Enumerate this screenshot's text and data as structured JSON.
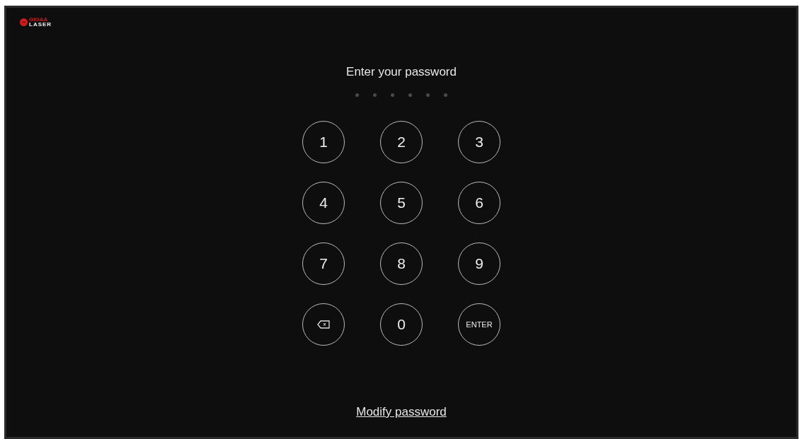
{
  "logo": {
    "line_1": "GIGAA",
    "line_2": "LASER"
  },
  "title": "Enter your password",
  "pin_dots": [
    {
      "filled": false
    },
    {
      "filled": false
    },
    {
      "filled": false
    },
    {
      "filled": false
    },
    {
      "filled": false
    },
    {
      "filled": false
    }
  ],
  "keypad": [
    {
      "kind": "digit",
      "label": "1"
    },
    {
      "kind": "digit",
      "label": "2"
    },
    {
      "kind": "digit",
      "label": "3"
    },
    {
      "kind": "digit",
      "label": "4"
    },
    {
      "kind": "digit",
      "label": "5"
    },
    {
      "kind": "digit",
      "label": "6"
    },
    {
      "kind": "digit",
      "label": "7"
    },
    {
      "kind": "digit",
      "label": "8"
    },
    {
      "kind": "digit",
      "label": "9"
    },
    {
      "kind": "backspace"
    },
    {
      "kind": "digit",
      "label": "0"
    },
    {
      "kind": "enter",
      "label": "ENTER"
    }
  ],
  "modify_link": "Modify password"
}
